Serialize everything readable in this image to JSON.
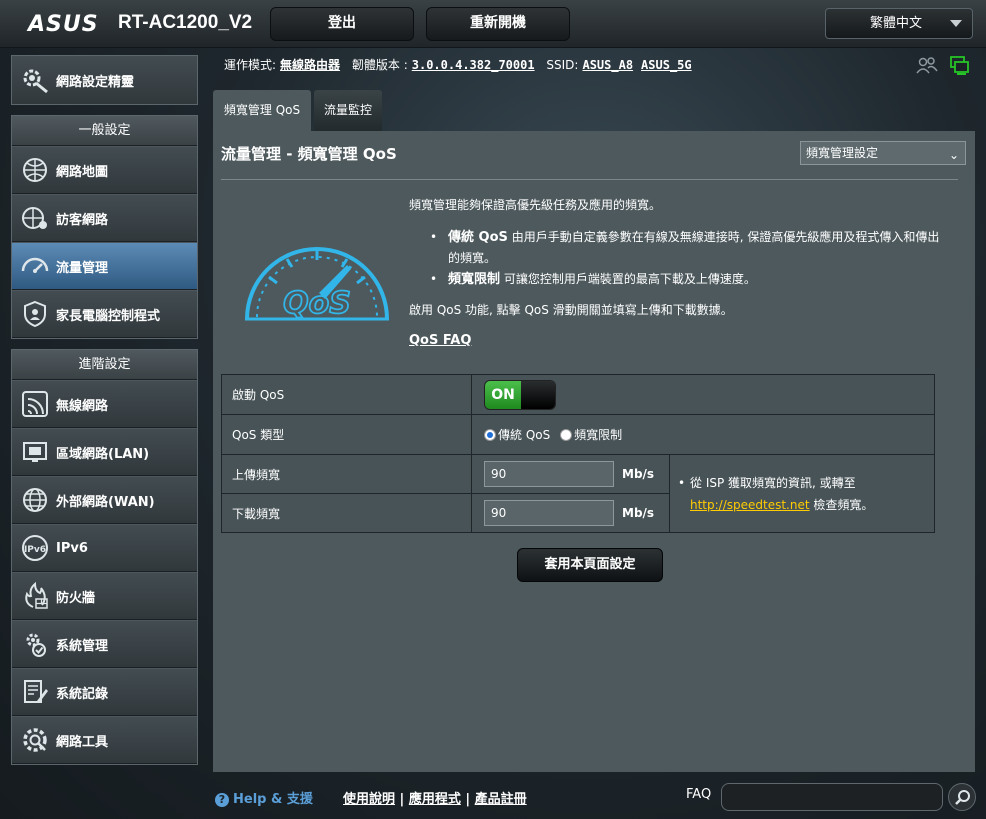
{
  "header": {
    "logo": "ASUS",
    "model": "RT-AC1200_V2",
    "logout_label": "登出",
    "reboot_label": "重新開機",
    "language": "繁體中文"
  },
  "status": {
    "mode_label": "運作模式:",
    "mode_value": "無線路由器",
    "firmware_label": "韌體版本 :",
    "firmware_value": "3.0.0.4.382_70001",
    "ssid_label": "SSID:",
    "ssid_1": "ASUS_A8",
    "ssid_2": "ASUS_5G"
  },
  "sidebar": {
    "wizard": "網路設定精靈",
    "general_header": "一般設定",
    "general_items": [
      "網路地圖",
      "訪客網路",
      "流量管理",
      "家長電腦控制程式"
    ],
    "advanced_header": "進階設定",
    "advanced_items": [
      "無線網路",
      "區域網路(LAN)",
      "外部網路(WAN)",
      "IPv6",
      "防火牆",
      "系統管理",
      "系統記錄",
      "網路工具"
    ],
    "active": "流量管理"
  },
  "tabs": [
    "頻寬管理 QoS",
    "流量監控"
  ],
  "main": {
    "title": "流量管理 - 頻寬管理 QoS",
    "select_value": "頻寬管理設定",
    "intro": "頻寬管理能夠保證高優先級任務及應用的頻寬。",
    "bullet1_bold": "傳統 QoS",
    "bullet1_text": " 由用戶手動自定義參數在有線及無線連接時, 保證高優先級應用及程式傳入和傳出的頻寬。",
    "bullet2_bold": "頻寬限制",
    "bullet2_text": " 可讓您控制用戶端裝置的最高下載及上傳速度。",
    "enable_text": "啟用 QoS 功能, 點擊 QoS 滑動開關並填寫上傳和下載數據。",
    "faq_link": "QoS FAQ",
    "logo_text": "QoS"
  },
  "settings": {
    "enable_label": "啟動 QoS",
    "toggle_on": "ON",
    "type_label": "QoS 類型",
    "type_option1": "傳統 QoS",
    "type_option2": "頻寬限制",
    "upload_label": "上傳頻寬",
    "upload_value": "90",
    "download_label": "下載頻寬",
    "download_value": "90",
    "unit": "Mb/s",
    "note_text": "從 ISP 獲取頻寬的資訊, 或轉至",
    "note_link": "http://speedtest.net",
    "note_suffix": " 檢查頻寬。",
    "apply_label": "套用本頁面設定"
  },
  "footer": {
    "help": "Help & 支援",
    "manual": "使用說明",
    "apps": "應用程式",
    "register": "產品註冊",
    "faq_label": "FAQ"
  },
  "colors": {
    "accent_blue": "#5b9fd8",
    "toggle_green": "#2fa32f",
    "link_yellow": "#ffcc00",
    "panel_bg": "#4d595d"
  }
}
